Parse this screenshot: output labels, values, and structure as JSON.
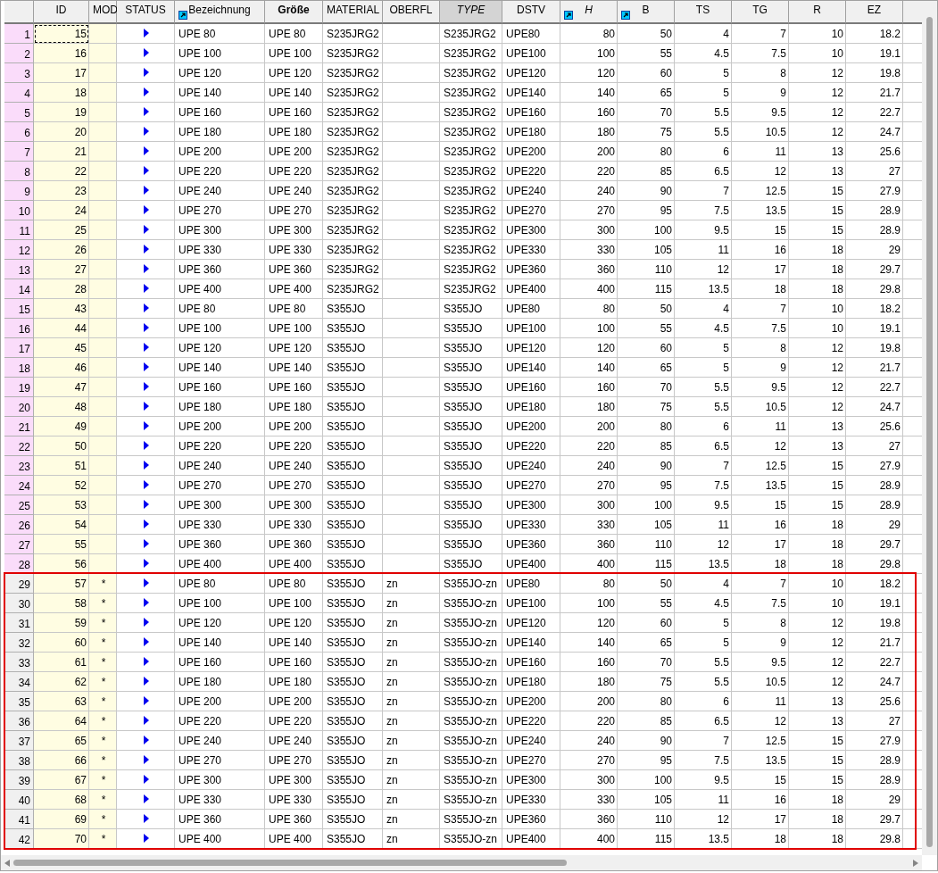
{
  "columns": [
    {
      "label": "ID",
      "kind": "id",
      "icon": false,
      "bold": false,
      "italic": false,
      "selected": false
    },
    {
      "label": "MOD",
      "kind": "mod",
      "icon": false,
      "bold": false,
      "italic": false,
      "selected": false
    },
    {
      "label": "STATUS",
      "kind": "status",
      "icon": false,
      "bold": false,
      "italic": false,
      "selected": false
    },
    {
      "label": "Bezeichnung",
      "kind": "text",
      "icon": true,
      "bold": false,
      "italic": false,
      "selected": false
    },
    {
      "label": "Größe",
      "kind": "text",
      "icon": false,
      "bold": true,
      "italic": false,
      "selected": false
    },
    {
      "label": "MATERIAL",
      "kind": "text",
      "icon": false,
      "bold": false,
      "italic": false,
      "selected": false
    },
    {
      "label": "OBERFL",
      "kind": "text",
      "icon": false,
      "bold": false,
      "italic": false,
      "selected": false
    },
    {
      "label": "TYPE",
      "kind": "text",
      "icon": false,
      "bold": false,
      "italic": true,
      "selected": true
    },
    {
      "label": "DSTV",
      "kind": "text",
      "icon": false,
      "bold": false,
      "italic": false,
      "selected": false
    },
    {
      "label": "H",
      "kind": "number",
      "icon": true,
      "bold": false,
      "italic": true,
      "selected": false
    },
    {
      "label": "B",
      "kind": "number",
      "icon": true,
      "bold": false,
      "italic": false,
      "selected": false
    },
    {
      "label": "TS",
      "kind": "number",
      "icon": false,
      "bold": false,
      "italic": false,
      "selected": false
    },
    {
      "label": "TG",
      "kind": "number",
      "icon": false,
      "bold": false,
      "italic": false,
      "selected": false
    },
    {
      "label": "R",
      "kind": "number",
      "icon": false,
      "bold": false,
      "italic": false,
      "selected": false
    },
    {
      "label": "EZ",
      "kind": "number",
      "icon": false,
      "bold": false,
      "italic": false,
      "selected": false
    }
  ],
  "rows": [
    {
      "n": "1",
      "marked": true,
      "focused": true,
      "boxed": false,
      "id": "15",
      "bez": "UPE 80",
      "gr": "UPE 80",
      "mat": "S235JRG2",
      "type": "S235JRG2",
      "dstv": "UPE80",
      "h": "80",
      "b": "50",
      "ts": "4",
      "tg": "7",
      "r": "10",
      "ez": "18.2"
    },
    {
      "n": "2",
      "marked": true,
      "focused": false,
      "boxed": false,
      "id": "16",
      "bez": "UPE 100",
      "gr": "UPE 100",
      "mat": "S235JRG2",
      "type": "S235JRG2",
      "dstv": "UPE100",
      "h": "100",
      "b": "55",
      "ts": "4.5",
      "tg": "7.5",
      "r": "10",
      "ez": "19.1"
    },
    {
      "n": "3",
      "marked": true,
      "focused": false,
      "boxed": false,
      "id": "17",
      "bez": "UPE 120",
      "gr": "UPE 120",
      "mat": "S235JRG2",
      "type": "S235JRG2",
      "dstv": "UPE120",
      "h": "120",
      "b": "60",
      "ts": "5",
      "tg": "8",
      "r": "12",
      "ez": "19.8"
    },
    {
      "n": "4",
      "marked": true,
      "focused": false,
      "boxed": false,
      "id": "18",
      "bez": "UPE 140",
      "gr": "UPE 140",
      "mat": "S235JRG2",
      "type": "S235JRG2",
      "dstv": "UPE140",
      "h": "140",
      "b": "65",
      "ts": "5",
      "tg": "9",
      "r": "12",
      "ez": "21.7"
    },
    {
      "n": "5",
      "marked": true,
      "focused": false,
      "boxed": false,
      "id": "19",
      "bez": "UPE 160",
      "gr": "UPE 160",
      "mat": "S235JRG2",
      "type": "S235JRG2",
      "dstv": "UPE160",
      "h": "160",
      "b": "70",
      "ts": "5.5",
      "tg": "9.5",
      "r": "12",
      "ez": "22.7"
    },
    {
      "n": "6",
      "marked": true,
      "focused": false,
      "boxed": false,
      "id": "20",
      "bez": "UPE 180",
      "gr": "UPE 180",
      "mat": "S235JRG2",
      "type": "S235JRG2",
      "dstv": "UPE180",
      "h": "180",
      "b": "75",
      "ts": "5.5",
      "tg": "10.5",
      "r": "12",
      "ez": "24.7"
    },
    {
      "n": "7",
      "marked": true,
      "focused": false,
      "boxed": false,
      "id": "21",
      "bez": "UPE 200",
      "gr": "UPE 200",
      "mat": "S235JRG2",
      "type": "S235JRG2",
      "dstv": "UPE200",
      "h": "200",
      "b": "80",
      "ts": "6",
      "tg": "11",
      "r": "13",
      "ez": "25.6"
    },
    {
      "n": "8",
      "marked": true,
      "focused": false,
      "boxed": false,
      "id": "22",
      "bez": "UPE 220",
      "gr": "UPE 220",
      "mat": "S235JRG2",
      "type": "S235JRG2",
      "dstv": "UPE220",
      "h": "220",
      "b": "85",
      "ts": "6.5",
      "tg": "12",
      "r": "13",
      "ez": "27"
    },
    {
      "n": "9",
      "marked": true,
      "focused": false,
      "boxed": false,
      "id": "23",
      "bez": "UPE 240",
      "gr": "UPE 240",
      "mat": "S235JRG2",
      "type": "S235JRG2",
      "dstv": "UPE240",
      "h": "240",
      "b": "90",
      "ts": "7",
      "tg": "12.5",
      "r": "15",
      "ez": "27.9"
    },
    {
      "n": "10",
      "marked": true,
      "focused": false,
      "boxed": false,
      "id": "24",
      "bez": "UPE 270",
      "gr": "UPE 270",
      "mat": "S235JRG2",
      "type": "S235JRG2",
      "dstv": "UPE270",
      "h": "270",
      "b": "95",
      "ts": "7.5",
      "tg": "13.5",
      "r": "15",
      "ez": "28.9"
    },
    {
      "n": "11",
      "marked": true,
      "focused": false,
      "boxed": false,
      "id": "25",
      "bez": "UPE 300",
      "gr": "UPE 300",
      "mat": "S235JRG2",
      "type": "S235JRG2",
      "dstv": "UPE300",
      "h": "300",
      "b": "100",
      "ts": "9.5",
      "tg": "15",
      "r": "15",
      "ez": "28.9"
    },
    {
      "n": "12",
      "marked": true,
      "focused": false,
      "boxed": false,
      "id": "26",
      "bez": "UPE 330",
      "gr": "UPE 330",
      "mat": "S235JRG2",
      "type": "S235JRG2",
      "dstv": "UPE330",
      "h": "330",
      "b": "105",
      "ts": "11",
      "tg": "16",
      "r": "18",
      "ez": "29"
    },
    {
      "n": "13",
      "marked": true,
      "focused": false,
      "boxed": false,
      "id": "27",
      "bez": "UPE 360",
      "gr": "UPE 360",
      "mat": "S235JRG2",
      "type": "S235JRG2",
      "dstv": "UPE360",
      "h": "360",
      "b": "110",
      "ts": "12",
      "tg": "17",
      "r": "18",
      "ez": "29.7"
    },
    {
      "n": "14",
      "marked": true,
      "focused": false,
      "boxed": false,
      "id": "28",
      "bez": "UPE 400",
      "gr": "UPE 400",
      "mat": "S235JRG2",
      "type": "S235JRG2",
      "dstv": "UPE400",
      "h": "400",
      "b": "115",
      "ts": "13.5",
      "tg": "18",
      "r": "18",
      "ez": "29.8"
    },
    {
      "n": "15",
      "marked": true,
      "focused": false,
      "boxed": false,
      "id": "43",
      "bez": "UPE 80",
      "gr": "UPE 80",
      "mat": "S355JO",
      "type": "S355JO",
      "dstv": "UPE80",
      "h": "80",
      "b": "50",
      "ts": "4",
      "tg": "7",
      "r": "10",
      "ez": "18.2"
    },
    {
      "n": "16",
      "marked": true,
      "focused": false,
      "boxed": false,
      "id": "44",
      "bez": "UPE 100",
      "gr": "UPE 100",
      "mat": "S355JO",
      "type": "S355JO",
      "dstv": "UPE100",
      "h": "100",
      "b": "55",
      "ts": "4.5",
      "tg": "7.5",
      "r": "10",
      "ez": "19.1"
    },
    {
      "n": "17",
      "marked": true,
      "focused": false,
      "boxed": false,
      "id": "45",
      "bez": "UPE 120",
      "gr": "UPE 120",
      "mat": "S355JO",
      "type": "S355JO",
      "dstv": "UPE120",
      "h": "120",
      "b": "60",
      "ts": "5",
      "tg": "8",
      "r": "12",
      "ez": "19.8"
    },
    {
      "n": "18",
      "marked": true,
      "focused": false,
      "boxed": false,
      "id": "46",
      "bez": "UPE 140",
      "gr": "UPE 140",
      "mat": "S355JO",
      "type": "S355JO",
      "dstv": "UPE140",
      "h": "140",
      "b": "65",
      "ts": "5",
      "tg": "9",
      "r": "12",
      "ez": "21.7"
    },
    {
      "n": "19",
      "marked": true,
      "focused": false,
      "boxed": false,
      "id": "47",
      "bez": "UPE 160",
      "gr": "UPE 160",
      "mat": "S355JO",
      "type": "S355JO",
      "dstv": "UPE160",
      "h": "160",
      "b": "70",
      "ts": "5.5",
      "tg": "9.5",
      "r": "12",
      "ez": "22.7"
    },
    {
      "n": "20",
      "marked": true,
      "focused": false,
      "boxed": false,
      "id": "48",
      "bez": "UPE 180",
      "gr": "UPE 180",
      "mat": "S355JO",
      "type": "S355JO",
      "dstv": "UPE180",
      "h": "180",
      "b": "75",
      "ts": "5.5",
      "tg": "10.5",
      "r": "12",
      "ez": "24.7"
    },
    {
      "n": "21",
      "marked": true,
      "focused": false,
      "boxed": false,
      "id": "49",
      "bez": "UPE 200",
      "gr": "UPE 200",
      "mat": "S355JO",
      "type": "S355JO",
      "dstv": "UPE200",
      "h": "200",
      "b": "80",
      "ts": "6",
      "tg": "11",
      "r": "13",
      "ez": "25.6"
    },
    {
      "n": "22",
      "marked": true,
      "focused": false,
      "boxed": false,
      "id": "50",
      "bez": "UPE 220",
      "gr": "UPE 220",
      "mat": "S355JO",
      "type": "S355JO",
      "dstv": "UPE220",
      "h": "220",
      "b": "85",
      "ts": "6.5",
      "tg": "12",
      "r": "13",
      "ez": "27"
    },
    {
      "n": "23",
      "marked": true,
      "focused": false,
      "boxed": false,
      "id": "51",
      "bez": "UPE 240",
      "gr": "UPE 240",
      "mat": "S355JO",
      "type": "S355JO",
      "dstv": "UPE240",
      "h": "240",
      "b": "90",
      "ts": "7",
      "tg": "12.5",
      "r": "15",
      "ez": "27.9"
    },
    {
      "n": "24",
      "marked": true,
      "focused": false,
      "boxed": false,
      "id": "52",
      "bez": "UPE 270",
      "gr": "UPE 270",
      "mat": "S355JO",
      "type": "S355JO",
      "dstv": "UPE270",
      "h": "270",
      "b": "95",
      "ts": "7.5",
      "tg": "13.5",
      "r": "15",
      "ez": "28.9"
    },
    {
      "n": "25",
      "marked": true,
      "focused": false,
      "boxed": false,
      "id": "53",
      "bez": "UPE 300",
      "gr": "UPE 300",
      "mat": "S355JO",
      "type": "S355JO",
      "dstv": "UPE300",
      "h": "300",
      "b": "100",
      "ts": "9.5",
      "tg": "15",
      "r": "15",
      "ez": "28.9"
    },
    {
      "n": "26",
      "marked": true,
      "focused": false,
      "boxed": false,
      "id": "54",
      "bez": "UPE 330",
      "gr": "UPE 330",
      "mat": "S355JO",
      "type": "S355JO",
      "dstv": "UPE330",
      "h": "330",
      "b": "105",
      "ts": "11",
      "tg": "16",
      "r": "18",
      "ez": "29"
    },
    {
      "n": "27",
      "marked": true,
      "focused": false,
      "boxed": false,
      "id": "55",
      "bez": "UPE 360",
      "gr": "UPE 360",
      "mat": "S355JO",
      "type": "S355JO",
      "dstv": "UPE360",
      "h": "360",
      "b": "110",
      "ts": "12",
      "tg": "17",
      "r": "18",
      "ez": "29.7"
    },
    {
      "n": "28",
      "marked": true,
      "focused": false,
      "boxed": false,
      "id": "56",
      "bez": "UPE 400",
      "gr": "UPE 400",
      "mat": "S355JO",
      "type": "S355JO",
      "dstv": "UPE400",
      "h": "400",
      "b": "115",
      "ts": "13.5",
      "tg": "18",
      "r": "18",
      "ez": "29.8"
    },
    {
      "n": "29",
      "marked": false,
      "focused": false,
      "boxed": true,
      "id": "57",
      "mod": "*",
      "bez": "UPE 80",
      "gr": "UPE 80",
      "mat": "S355JO",
      "ob": "zn",
      "type": "S355JO-zn",
      "dstv": "UPE80",
      "h": "80",
      "b": "50",
      "ts": "4",
      "tg": "7",
      "r": "10",
      "ez": "18.2"
    },
    {
      "n": "30",
      "marked": false,
      "focused": false,
      "boxed": true,
      "id": "58",
      "mod": "*",
      "bez": "UPE 100",
      "gr": "UPE 100",
      "mat": "S355JO",
      "ob": "zn",
      "type": "S355JO-zn",
      "dstv": "UPE100",
      "h": "100",
      "b": "55",
      "ts": "4.5",
      "tg": "7.5",
      "r": "10",
      "ez": "19.1"
    },
    {
      "n": "31",
      "marked": false,
      "focused": false,
      "boxed": true,
      "id": "59",
      "mod": "*",
      "bez": "UPE 120",
      "gr": "UPE 120",
      "mat": "S355JO",
      "ob": "zn",
      "type": "S355JO-zn",
      "dstv": "UPE120",
      "h": "120",
      "b": "60",
      "ts": "5",
      "tg": "8",
      "r": "12",
      "ez": "19.8"
    },
    {
      "n": "32",
      "marked": false,
      "focused": false,
      "boxed": true,
      "id": "60",
      "mod": "*",
      "bez": "UPE 140",
      "gr": "UPE 140",
      "mat": "S355JO",
      "ob": "zn",
      "type": "S355JO-zn",
      "dstv": "UPE140",
      "h": "140",
      "b": "65",
      "ts": "5",
      "tg": "9",
      "r": "12",
      "ez": "21.7"
    },
    {
      "n": "33",
      "marked": false,
      "focused": false,
      "boxed": true,
      "id": "61",
      "mod": "*",
      "bez": "UPE 160",
      "gr": "UPE 160",
      "mat": "S355JO",
      "ob": "zn",
      "type": "S355JO-zn",
      "dstv": "UPE160",
      "h": "160",
      "b": "70",
      "ts": "5.5",
      "tg": "9.5",
      "r": "12",
      "ez": "22.7"
    },
    {
      "n": "34",
      "marked": false,
      "focused": false,
      "boxed": true,
      "id": "62",
      "mod": "*",
      "bez": "UPE 180",
      "gr": "UPE 180",
      "mat": "S355JO",
      "ob": "zn",
      "type": "S355JO-zn",
      "dstv": "UPE180",
      "h": "180",
      "b": "75",
      "ts": "5.5",
      "tg": "10.5",
      "r": "12",
      "ez": "24.7"
    },
    {
      "n": "35",
      "marked": false,
      "focused": false,
      "boxed": true,
      "id": "63",
      "mod": "*",
      "bez": "UPE 200",
      "gr": "UPE 200",
      "mat": "S355JO",
      "ob": "zn",
      "type": "S355JO-zn",
      "dstv": "UPE200",
      "h": "200",
      "b": "80",
      "ts": "6",
      "tg": "11",
      "r": "13",
      "ez": "25.6"
    },
    {
      "n": "36",
      "marked": false,
      "focused": false,
      "boxed": true,
      "id": "64",
      "mod": "*",
      "bez": "UPE 220",
      "gr": "UPE 220",
      "mat": "S355JO",
      "ob": "zn",
      "type": "S355JO-zn",
      "dstv": "UPE220",
      "h": "220",
      "b": "85",
      "ts": "6.5",
      "tg": "12",
      "r": "13",
      "ez": "27"
    },
    {
      "n": "37",
      "marked": false,
      "focused": false,
      "boxed": true,
      "id": "65",
      "mod": "*",
      "bez": "UPE 240",
      "gr": "UPE 240",
      "mat": "S355JO",
      "ob": "zn",
      "type": "S355JO-zn",
      "dstv": "UPE240",
      "h": "240",
      "b": "90",
      "ts": "7",
      "tg": "12.5",
      "r": "15",
      "ez": "27.9"
    },
    {
      "n": "38",
      "marked": false,
      "focused": false,
      "boxed": true,
      "id": "66",
      "mod": "*",
      "bez": "UPE 270",
      "gr": "UPE 270",
      "mat": "S355JO",
      "ob": "zn",
      "type": "S355JO-zn",
      "dstv": "UPE270",
      "h": "270",
      "b": "95",
      "ts": "7.5",
      "tg": "13.5",
      "r": "15",
      "ez": "28.9"
    },
    {
      "n": "39",
      "marked": false,
      "focused": false,
      "boxed": true,
      "id": "67",
      "mod": "*",
      "bez": "UPE 300",
      "gr": "UPE 300",
      "mat": "S355JO",
      "ob": "zn",
      "type": "S355JO-zn",
      "dstv": "UPE300",
      "h": "300",
      "b": "100",
      "ts": "9.5",
      "tg": "15",
      "r": "15",
      "ez": "28.9"
    },
    {
      "n": "40",
      "marked": false,
      "focused": false,
      "boxed": true,
      "id": "68",
      "mod": "*",
      "bez": "UPE 330",
      "gr": "UPE 330",
      "mat": "S355JO",
      "ob": "zn",
      "type": "S355JO-zn",
      "dstv": "UPE330",
      "h": "330",
      "b": "105",
      "ts": "11",
      "tg": "16",
      "r": "18",
      "ez": "29"
    },
    {
      "n": "41",
      "marked": false,
      "focused": false,
      "boxed": true,
      "id": "69",
      "mod": "*",
      "bez": "UPE 360",
      "gr": "UPE 360",
      "mat": "S355JO",
      "ob": "zn",
      "type": "S355JO-zn",
      "dstv": "UPE360",
      "h": "360",
      "b": "110",
      "ts": "12",
      "tg": "17",
      "r": "18",
      "ez": "29.7"
    },
    {
      "n": "42",
      "marked": false,
      "focused": false,
      "boxed": true,
      "id": "70",
      "mod": "*",
      "bez": "UPE 400",
      "gr": "UPE 400",
      "mat": "S355JO",
      "ob": "zn",
      "type": "S355JO-zn",
      "dstv": "UPE400",
      "h": "400",
      "b": "115",
      "ts": "13.5",
      "tg": "18",
      "r": "18",
      "ez": "29.8"
    }
  ]
}
